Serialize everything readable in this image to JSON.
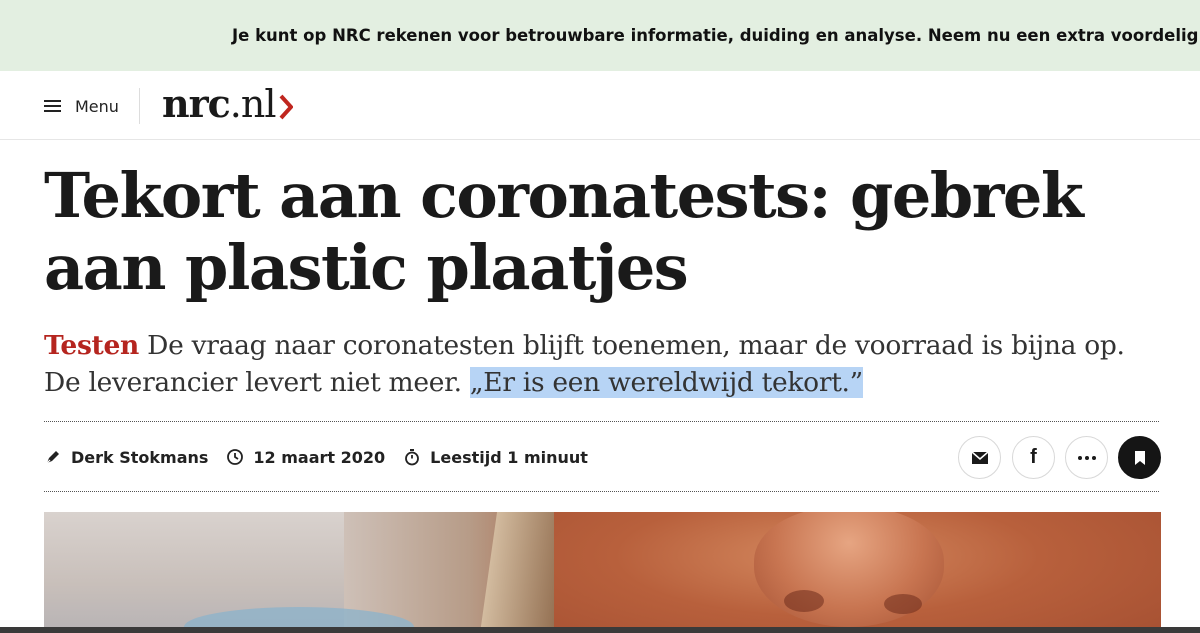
{
  "banner": {
    "text": "Je kunt op NRC rekenen voor betrouwbare informatie, duiding en analyse. Neem nu een extra voordelig abonnement"
  },
  "header": {
    "menu_label": "Menu",
    "menu_icon": "hamburger-icon",
    "logo": {
      "bold": "nrc",
      "light": ".nl",
      "accent_color": "#c0261f"
    }
  },
  "article": {
    "headline": "Tekort aan coronatests: gebrek aan plastic plaatjes",
    "lead": {
      "kicker": "Testen",
      "text": "De vraag naar coronatesten blijft toenemen, maar de voorraad is bijna op. De leverancier levert niet meer.",
      "quote": "„Er is een wereldwijd tekort.”"
    },
    "meta": {
      "author": "Derk Stokmans",
      "author_icon": "pen-icon",
      "date": "12 maart 2020",
      "date_icon": "clock-icon",
      "reading_time": "Leestijd 1 minuut",
      "reading_icon": "stopwatch-icon"
    },
    "share": [
      {
        "name": "mail",
        "icon": "mail-icon"
      },
      {
        "name": "facebook",
        "icon": "facebook-icon",
        "glyph": "f"
      },
      {
        "name": "more",
        "icon": "more-icon"
      },
      {
        "name": "bookmark",
        "icon": "bookmark-icon"
      }
    ]
  },
  "colors": {
    "banner_bg": "#e3efe1",
    "kicker": "#b5251f",
    "highlight": "#b7d4f5"
  }
}
